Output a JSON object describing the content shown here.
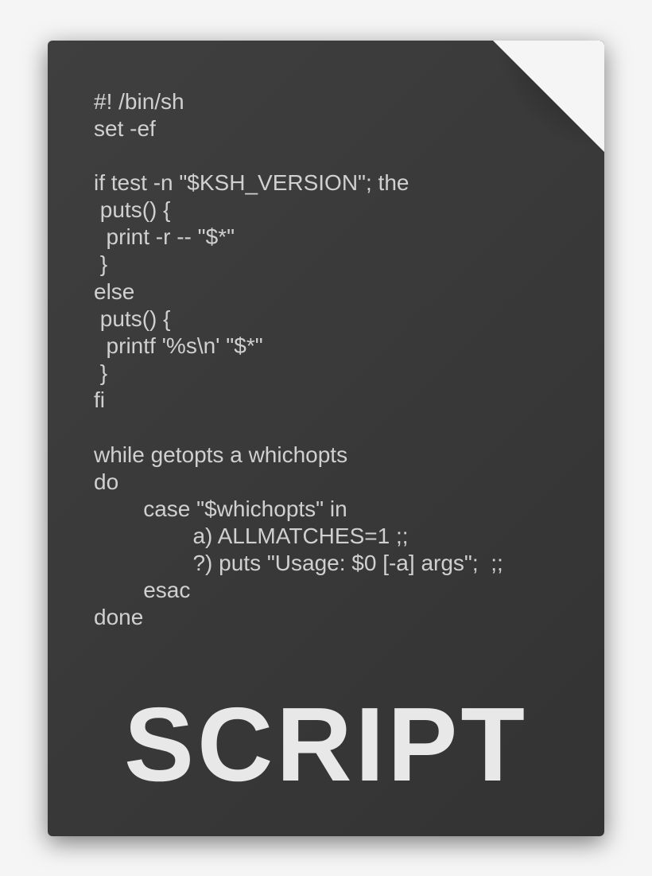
{
  "script": {
    "lines": [
      "#! /bin/sh",
      "set -ef",
      "",
      "if test -n \"$KSH_VERSION\"; the",
      " puts() {",
      "  print -r -- \"$*\"",
      " }",
      "else",
      " puts() {",
      "  printf '%s\\n' \"$*\"",
      " }",
      "fi",
      "",
      "while getopts a whichopts",
      "do",
      "        case \"$whichopts\" in",
      "                a) ALLMATCHES=1 ;;",
      "                ?) puts \"Usage: $0 [-a] args\";  ;;",
      "        esac",
      "done"
    ]
  },
  "title": "SCRIPT"
}
